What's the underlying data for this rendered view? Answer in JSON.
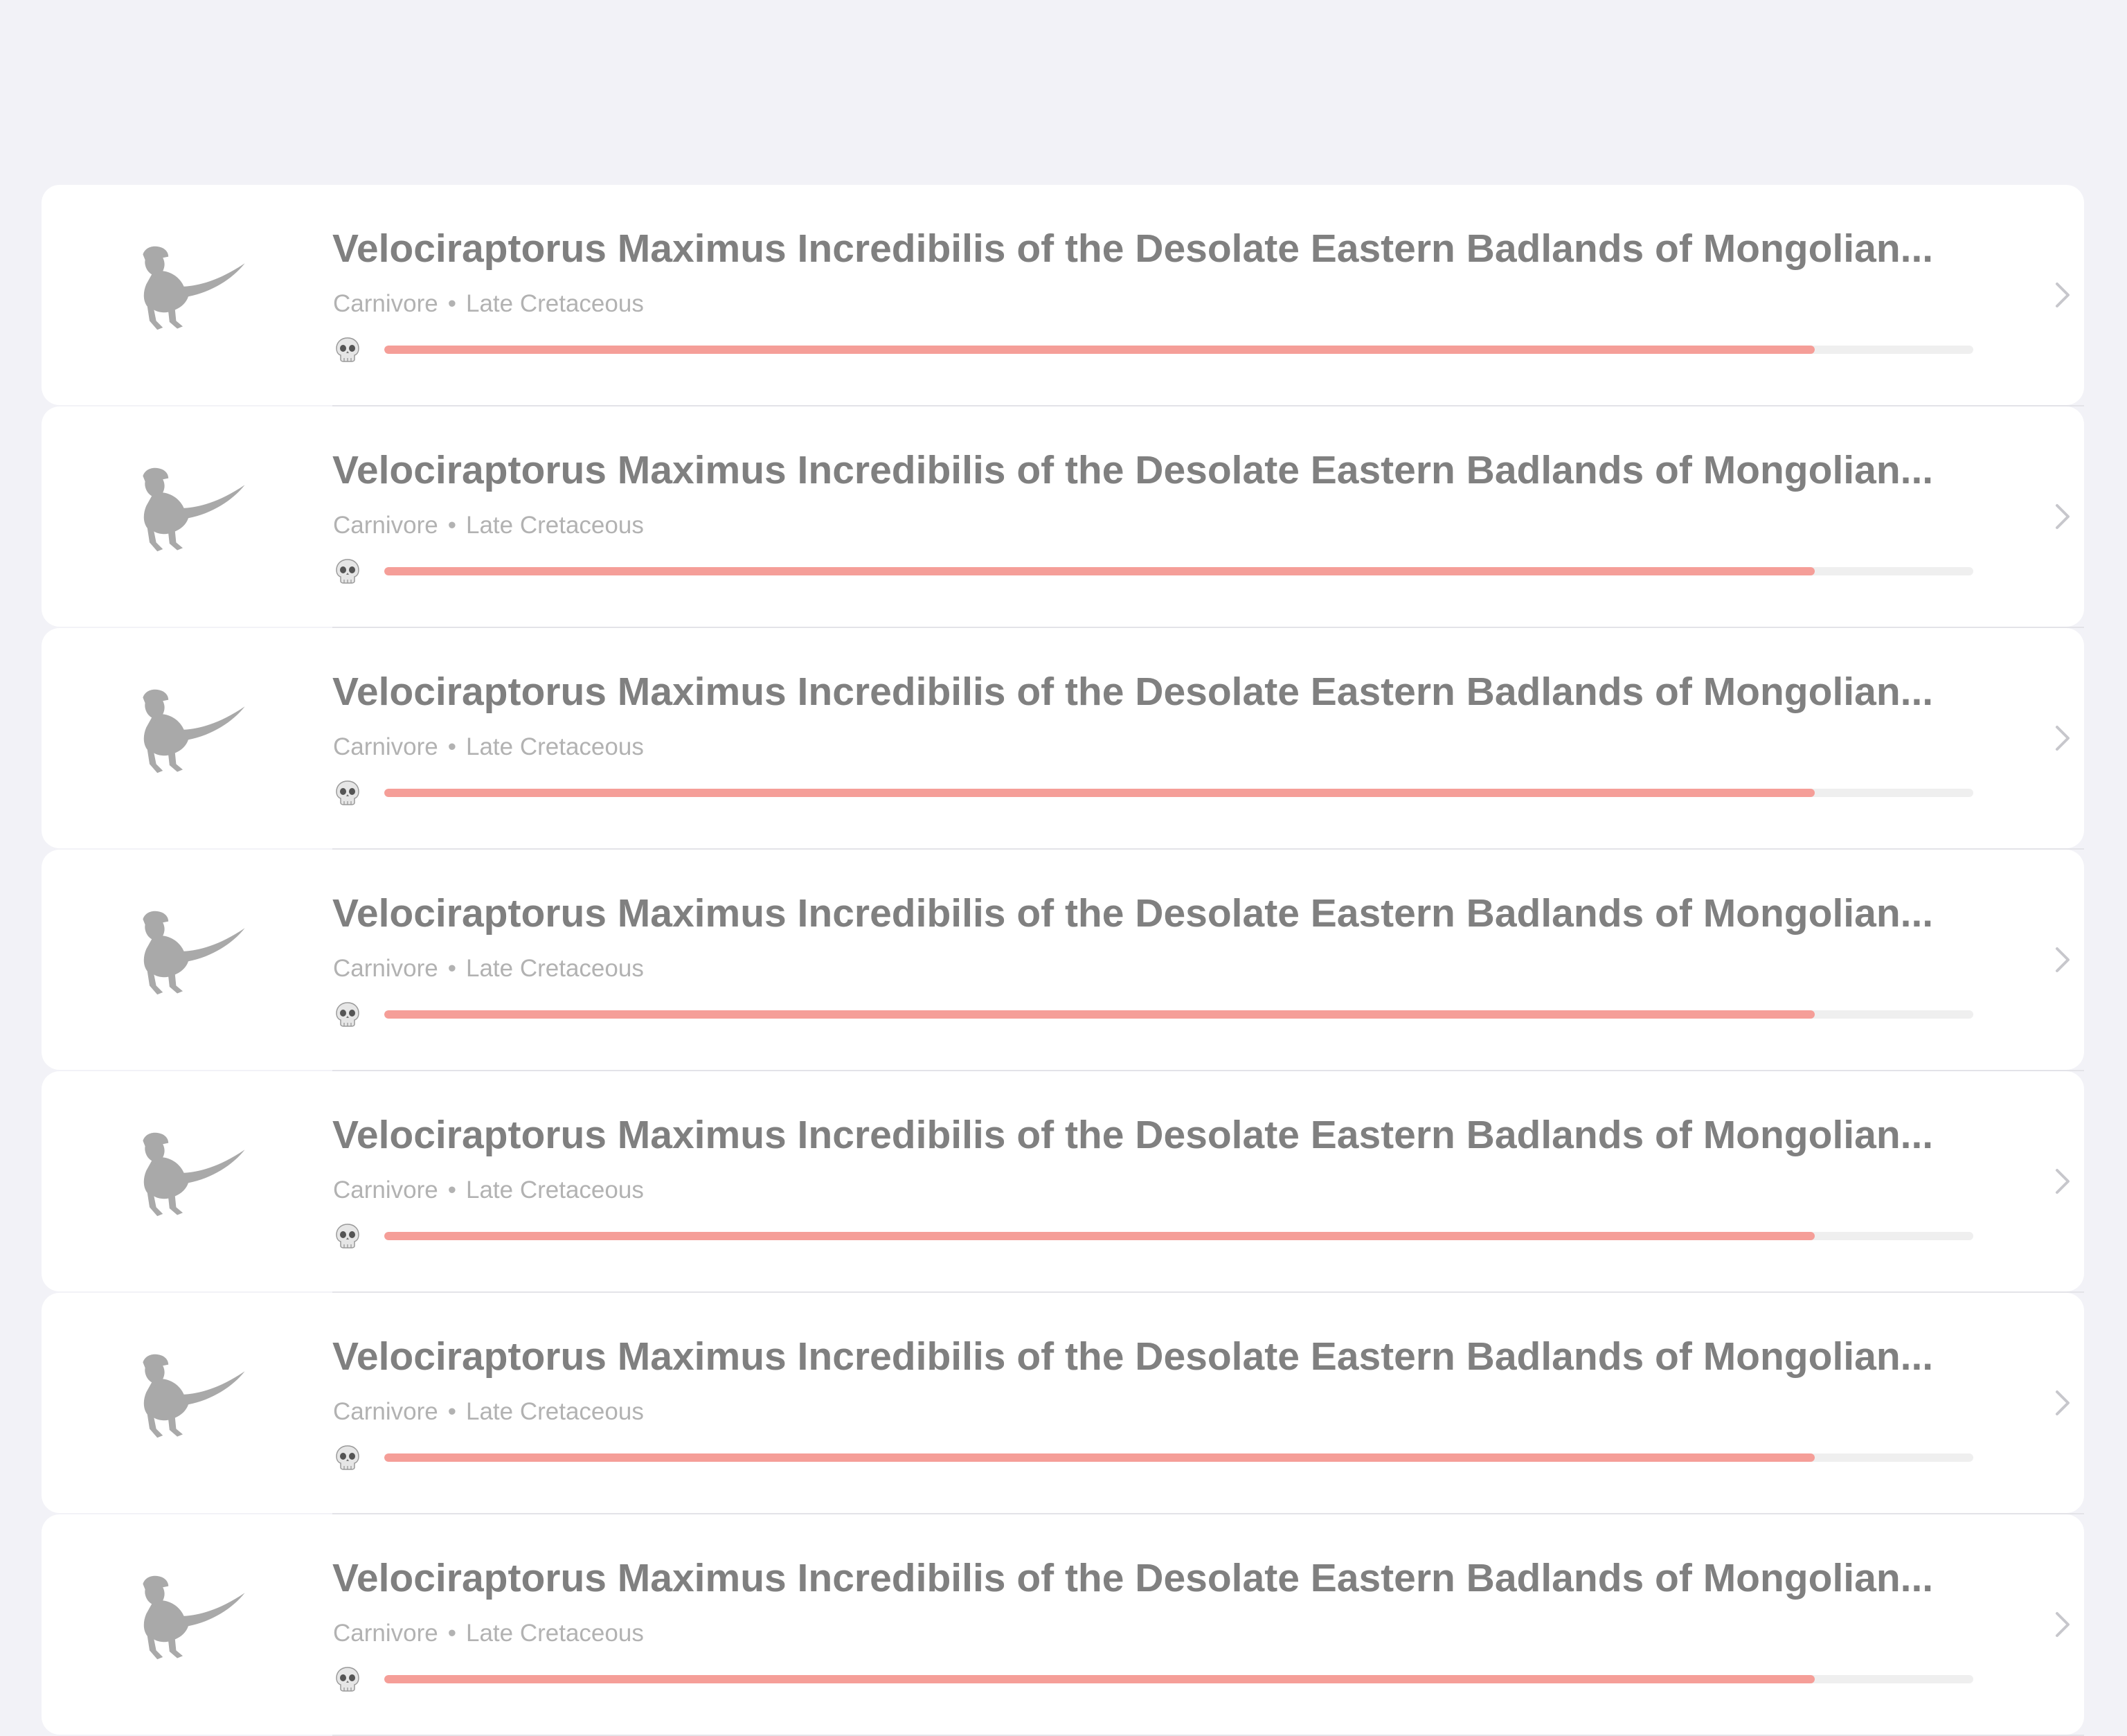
{
  "colors": {
    "background": "#f2f2f7",
    "card": "#ffffff",
    "title_text": "#808080",
    "meta_text": "#b2b2b2",
    "bar_fill": "#f59e98",
    "bar_track": "#efefef",
    "chevron": "#c7c7cc",
    "icon": "#a9a9a9"
  },
  "list": {
    "items": [
      {
        "title": "Velociraptorus Maximus Incredibilis of the Desolate Eastern Badlands of Mongolian...",
        "diet": "Carnivore",
        "separator": "•",
        "period": "Late Cretaceous",
        "icon": "raptor-icon",
        "threat_icon": "skull-icon",
        "threat_level": 0.9
      },
      {
        "title": "Velociraptorus Maximus Incredibilis of the Desolate Eastern Badlands of Mongolian...",
        "diet": "Carnivore",
        "separator": "•",
        "period": "Late Cretaceous",
        "icon": "raptor-icon",
        "threat_icon": "skull-icon",
        "threat_level": 0.9
      },
      {
        "title": "Velociraptorus Maximus Incredibilis of the Desolate Eastern Badlands of Mongolian...",
        "diet": "Carnivore",
        "separator": "•",
        "period": "Late Cretaceous",
        "icon": "raptor-icon",
        "threat_icon": "skull-icon",
        "threat_level": 0.9
      },
      {
        "title": "Velociraptorus Maximus Incredibilis of the Desolate Eastern Badlands of Mongolian...",
        "diet": "Carnivore",
        "separator": "•",
        "period": "Late Cretaceous",
        "icon": "raptor-icon",
        "threat_icon": "skull-icon",
        "threat_level": 0.9
      },
      {
        "title": "Velociraptorus Maximus Incredibilis of the Desolate Eastern Badlands of Mongolian...",
        "diet": "Carnivore",
        "separator": "•",
        "period": "Late Cretaceous",
        "icon": "raptor-icon",
        "threat_icon": "skull-icon",
        "threat_level": 0.9
      },
      {
        "title": "Velociraptorus Maximus Incredibilis of the Desolate Eastern Badlands of Mongolian...",
        "diet": "Carnivore",
        "separator": "•",
        "period": "Late Cretaceous",
        "icon": "raptor-icon",
        "threat_icon": "skull-icon",
        "threat_level": 0.9
      },
      {
        "title": "Velociraptorus Maximus Incredibilis of the Desolate Eastern Badlands of Mongolian...",
        "diet": "Carnivore",
        "separator": "•",
        "period": "Late Cretaceous",
        "icon": "raptor-icon",
        "threat_icon": "skull-icon",
        "threat_level": 0.9
      }
    ]
  }
}
